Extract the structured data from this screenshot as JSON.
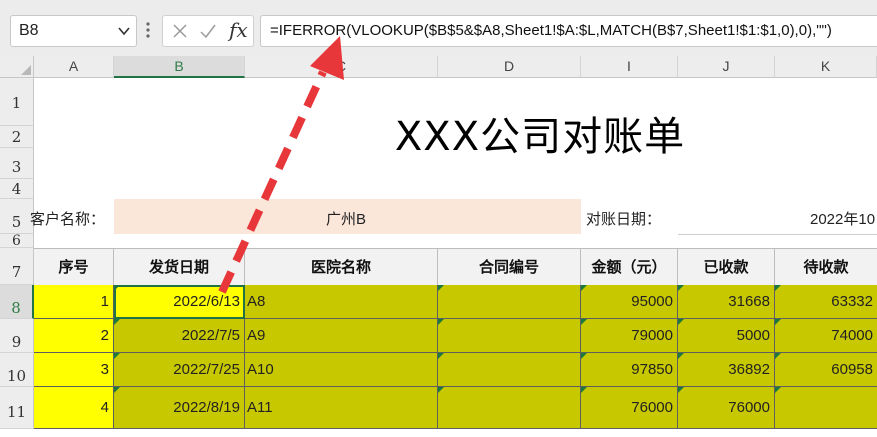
{
  "namebox": {
    "value": "B8"
  },
  "formula_bar": {
    "fx_label": "fx",
    "formula": "=IFERROR(VLOOKUP($B$5&$A8,Sheet1!$A:$L,MATCH(B$7,Sheet1!$1:$1,0),0),\"\")"
  },
  "columns": [
    "A",
    "B",
    "C",
    "D",
    "I",
    "J",
    "K"
  ],
  "rows": [
    "1",
    "2",
    "3",
    "4",
    "5",
    "6",
    "7",
    "8",
    "9",
    "10",
    "11"
  ],
  "sheet": {
    "title": "XXX公司对账单",
    "customer_label": "客户名称：",
    "customer_value": "广州B",
    "date_label": "对账日期：",
    "date_value": "2022年10",
    "headers": [
      "序号",
      "发货日期",
      "医院名称",
      "合同编号",
      "金额（元）",
      "已收款",
      "待收款"
    ],
    "data_rows": [
      {
        "seq": "1",
        "date": "2022/6/13",
        "hospital": "A8",
        "contract": "",
        "amount": "95000",
        "received": "31668",
        "pending": "63332"
      },
      {
        "seq": "2",
        "date": "2022/7/5",
        "hospital": "A9",
        "contract": "",
        "amount": "79000",
        "received": "5000",
        "pending": "74000"
      },
      {
        "seq": "3",
        "date": "2022/7/25",
        "hospital": "A10",
        "contract": "",
        "amount": "97850",
        "received": "36892",
        "pending": "60958"
      },
      {
        "seq": "4",
        "date": "2022/8/19",
        "hospital": "A11",
        "contract": "",
        "amount": "76000",
        "received": "76000",
        "pending": ""
      }
    ]
  },
  "colors": {
    "yellow": "#ffff00",
    "olive": "#c8c800",
    "accent": "#217346",
    "arrow": "#e8373a",
    "peach": "#fbe6da"
  },
  "icons": [
    "dropdown-arrow-icon",
    "cancel-x-icon",
    "enter-check-icon",
    "fx-icon",
    "red-dashed-arrow"
  ]
}
